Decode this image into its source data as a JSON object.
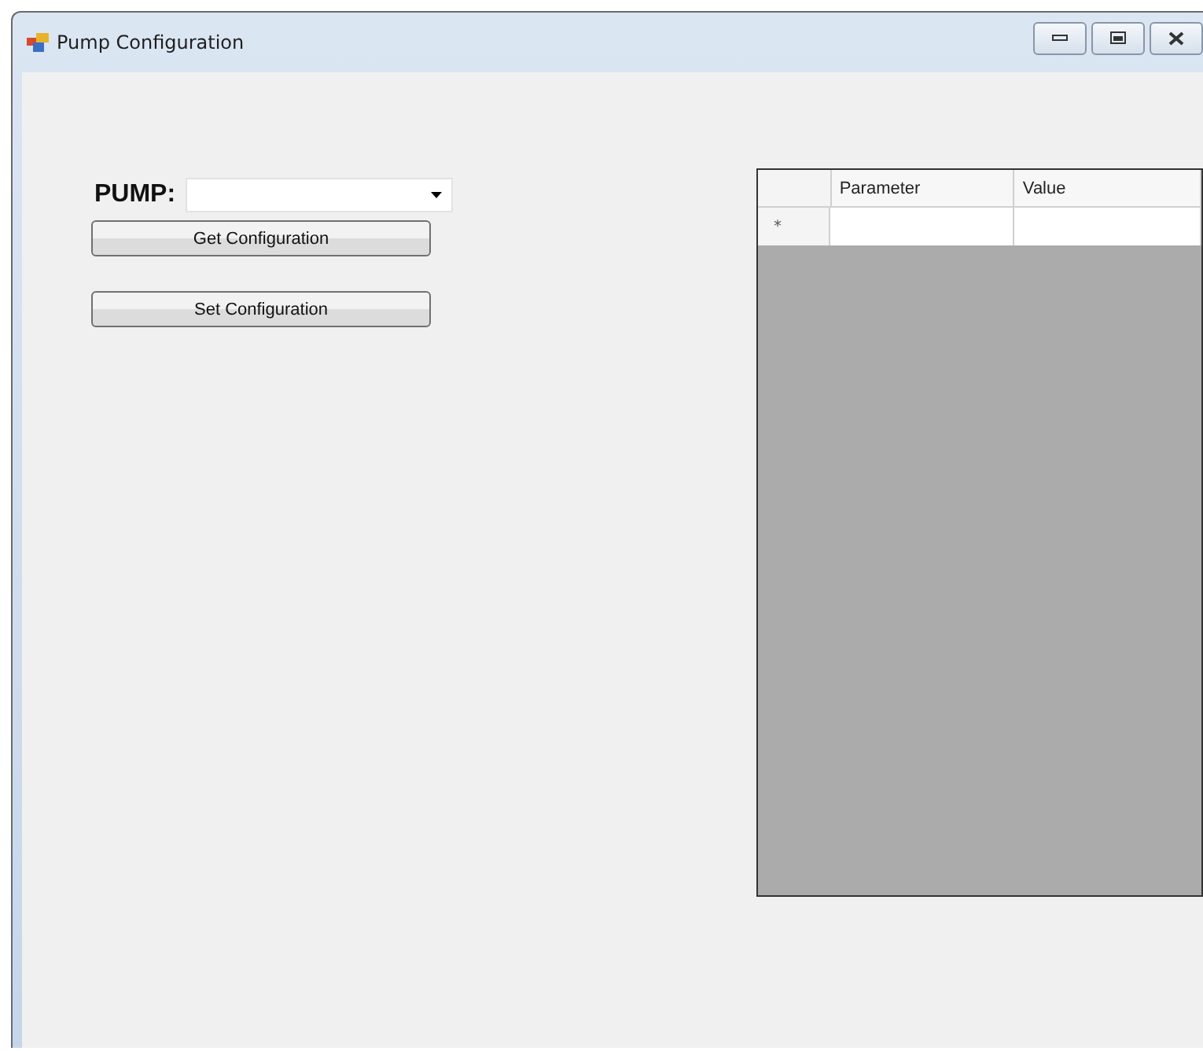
{
  "window": {
    "title": "Pump Configuration"
  },
  "pump_selector": {
    "label": "PUMP:"
  },
  "buttons": [
    {
      "label": "Get Configuration"
    },
    {
      "label": "Set Configuration"
    }
  ],
  "table": {
    "columns": [
      "Parameter",
      "Value"
    ],
    "new_row_marker": "*"
  }
}
